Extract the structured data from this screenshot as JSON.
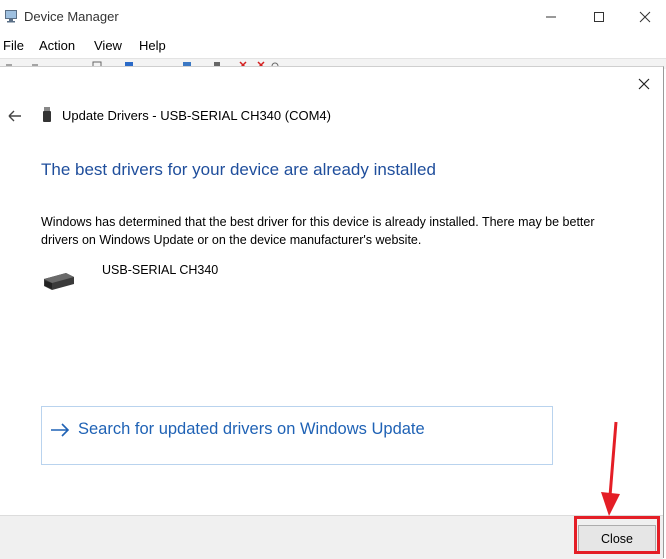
{
  "window": {
    "title": "Device Manager",
    "controls": {
      "minimize": "minimize-icon",
      "maximize": "maximize-icon",
      "close": "close-icon"
    }
  },
  "menu": {
    "items": [
      {
        "label": "File"
      },
      {
        "label": "Action"
      },
      {
        "label": "View"
      },
      {
        "label": "Help"
      }
    ]
  },
  "dialog": {
    "header_title": "Update Drivers - USB-SERIAL CH340 (COM4)",
    "heading": "The best drivers for your device are already installed",
    "description": "Windows has determined that the best driver for this device is already installed. There may be better drivers on Windows Update or on the device manufacturer's website.",
    "device_name": "USB-SERIAL CH340",
    "search_link": "Search for updated drivers on Windows Update",
    "close_button": "Close"
  },
  "colors": {
    "heading": "#1f4e9c",
    "link": "#1f62b5",
    "link_border": "#b9d3ee",
    "annotation": "#e41e26"
  },
  "annotation": {
    "highlight_target": "close-button",
    "arrow_icon": "red-arrow-down"
  }
}
